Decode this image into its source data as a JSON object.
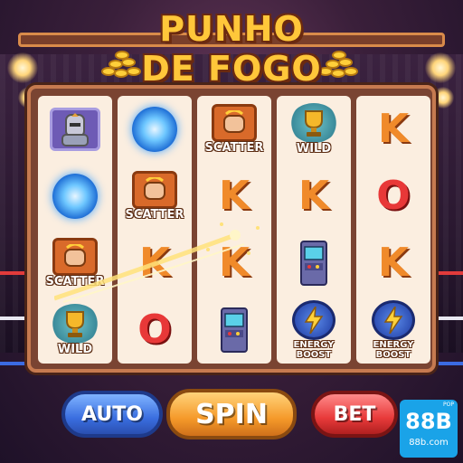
{
  "game": {
    "title_line1": "PUNHO",
    "title_line2": "DE FOGO"
  },
  "reels": [
    [
      {
        "symbol": "knight-icon",
        "label": ""
      },
      {
        "symbol": "vortex-icon",
        "label": ""
      },
      {
        "symbol": "fist-icon",
        "label": "SCATTER"
      },
      {
        "symbol": "trophy-icon",
        "label": "WILD"
      }
    ],
    [
      {
        "symbol": "vortex-icon",
        "label": ""
      },
      {
        "symbol": "fist-icon",
        "label": "SCATTER"
      },
      {
        "symbol": "letter",
        "label": "K"
      },
      {
        "symbol": "letter",
        "label": "O"
      }
    ],
    [
      {
        "symbol": "fist-icon",
        "label": "SCATTER"
      },
      {
        "symbol": "letter",
        "label": "K"
      },
      {
        "symbol": "letter",
        "label": "K"
      },
      {
        "symbol": "arcade-icon",
        "label": ""
      }
    ],
    [
      {
        "symbol": "trophy-icon",
        "label": "WILD"
      },
      {
        "symbol": "letter",
        "label": "K"
      },
      {
        "symbol": "arcade-icon",
        "label": ""
      },
      {
        "symbol": "bolt-icon",
        "label": "ENERGY BOOST"
      }
    ],
    [
      {
        "symbol": "letter",
        "label": "K"
      },
      {
        "symbol": "letter",
        "label": "O"
      },
      {
        "symbol": "letter",
        "label": "K"
      },
      {
        "symbol": "bolt-icon",
        "label": "ENERGY BOOST"
      }
    ]
  ],
  "controls": {
    "auto_label": "AUTO",
    "spin_label": "SPIN",
    "bet_label": "BET"
  },
  "brand": {
    "tiny": "POP",
    "name": "88B",
    "url": "88b.com"
  },
  "colors": {
    "accent": "#ffc73a",
    "auto": "#3a6ee0",
    "spin": "#f59a2a",
    "bet": "#e83a3a",
    "badge": "#1aa3e8"
  }
}
